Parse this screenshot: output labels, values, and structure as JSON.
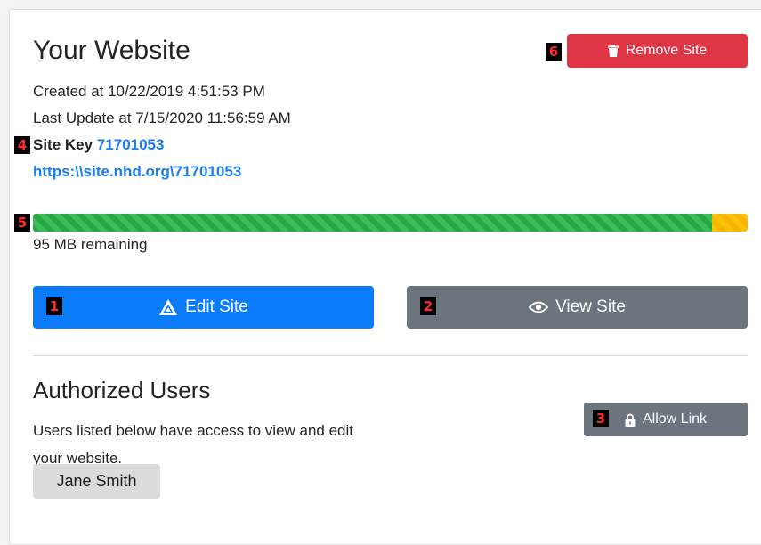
{
  "site": {
    "title": "Your Website",
    "created": "Created at 10/22/2019 4:51:53 PM",
    "updated": "Last Update at 7/15/2020 11:56:59 AM",
    "key_label": "Site Key",
    "key_value": "71701053",
    "url": "https:\\\\site.nhd.org\\71701053"
  },
  "storage": {
    "used_fraction": 0.95,
    "remaining_text": "95 MB remaining"
  },
  "buttons": {
    "remove": "Remove Site",
    "edit": "Edit Site",
    "view": "View Site",
    "allow": "Allow Link"
  },
  "authorized": {
    "title": "Authorized Users",
    "description": "Users listed below have access to view and edit your website.",
    "users": [
      "Jane Smith"
    ]
  },
  "markers": {
    "edit": "1",
    "view": "2",
    "allow": "3",
    "site_key": "4",
    "storage": "5",
    "remove": "6"
  },
  "colors": {
    "primary": "#0a7cfb",
    "danger": "#df3545",
    "secondary": "#6c757d",
    "success": "#28a745",
    "warning": "#ffc107",
    "link": "#1a7cf2"
  },
  "icons": {
    "remove": "trash-icon",
    "edit": "warning-triangle-icon",
    "view": "eye-icon",
    "allow": "lock-icon"
  }
}
